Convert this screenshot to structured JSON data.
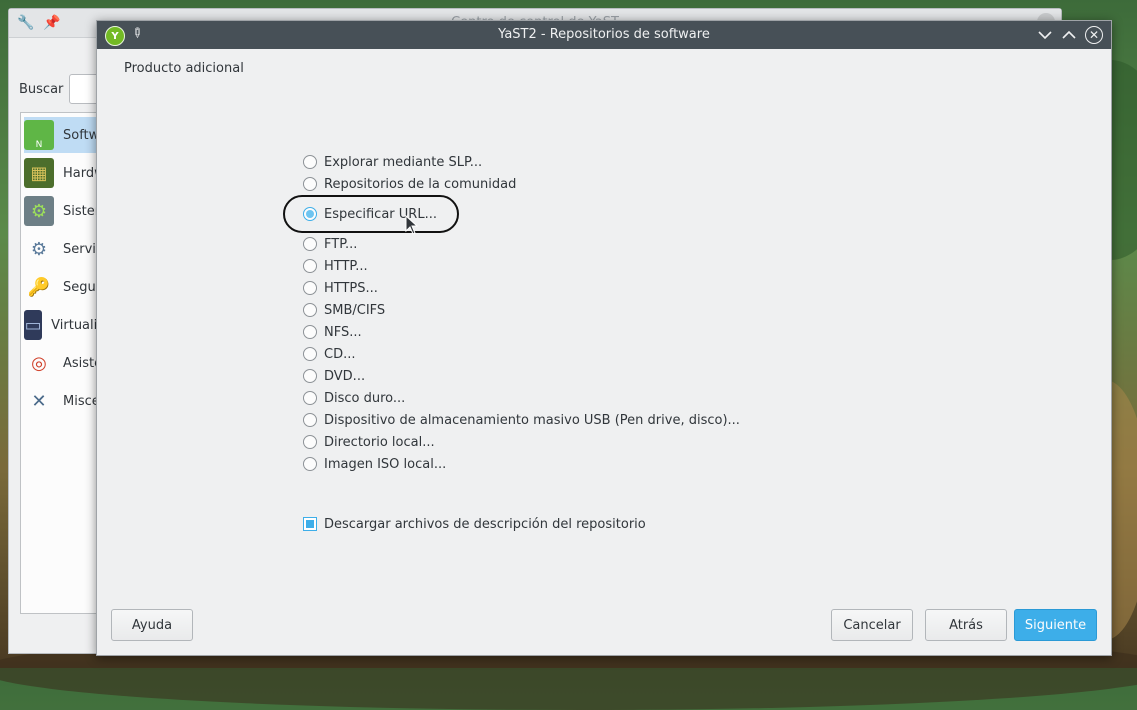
{
  "dialog": {
    "title": "YaST2 - Repositorios de software",
    "heading": "Producto adicional",
    "options": [
      {
        "label": "Explorar mediante SLP...",
        "checked": false
      },
      {
        "label": "Repositorios de la comunidad",
        "checked": false
      },
      {
        "label": "Especificar URL...",
        "checked": true
      },
      {
        "label": "FTP...",
        "checked": false
      },
      {
        "label": "HTTP...",
        "checked": false
      },
      {
        "label": "HTTPS...",
        "checked": false
      },
      {
        "label": "SMB/CIFS",
        "checked": false
      },
      {
        "label": "NFS...",
        "checked": false
      },
      {
        "label": "CD...",
        "checked": false
      },
      {
        "label": "DVD...",
        "checked": false
      },
      {
        "label": "Disco duro...",
        "checked": false
      },
      {
        "label": "Dispositivo de almacenamiento masivo USB (Pen drive, disco)...",
        "checked": false
      },
      {
        "label": "Directorio local...",
        "checked": false
      },
      {
        "label": "Imagen ISO local...",
        "checked": false
      }
    ],
    "download_checkbox": {
      "label": "Descargar archivos de descripción del repositorio",
      "checked": true
    },
    "buttons": {
      "help": "Ayuda",
      "cancel": "Cancelar",
      "back": "Atrás",
      "next": "Siguiente"
    }
  },
  "background_window": {
    "title": "Centro de control de YaST",
    "search_label": "Buscar",
    "categories": [
      {
        "label": "Software",
        "icon": "software-icon"
      },
      {
        "label": "Hardware",
        "icon": "hardware-icon"
      },
      {
        "label": "Sistema",
        "icon": "system-icon"
      },
      {
        "label": "Servicios",
        "icon": "services-icon"
      },
      {
        "label": "Seguridad",
        "icon": "security-icon"
      },
      {
        "label": "Virtualización",
        "icon": "virtualization-icon"
      },
      {
        "label": "Asistencia",
        "icon": "support-icon"
      },
      {
        "label": "Miscelánea",
        "icon": "misc-icon"
      }
    ]
  },
  "colors": {
    "accent": "#3daee9",
    "titlebar": "#475057",
    "window_bg": "#eff0f1"
  }
}
